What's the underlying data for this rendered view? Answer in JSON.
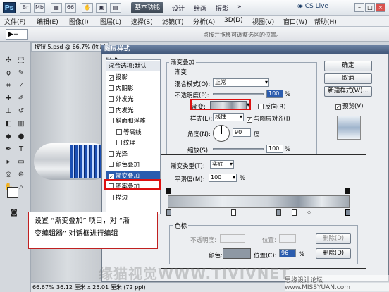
{
  "titlebar": {
    "app_logo": "Ps",
    "workspace_button": "基本功能",
    "workspace_items": [
      "设计",
      "绘画",
      "摄影"
    ],
    "cs_live": "CS Live",
    "window_controls": [
      "minimize-icon",
      "maximize-icon",
      "close-icon"
    ]
  },
  "menubar": {
    "items": [
      "文件(F)",
      "编辑(E)",
      "图像(I)",
      "图层(L)",
      "选择(S)",
      "滤镜(T)",
      "分析(A)",
      "3D(D)",
      "视图(V)",
      "窗口(W)",
      "帮助(H)"
    ]
  },
  "optionsbar": {
    "tool_preset": "▶+",
    "hint": "点按并拖移可调整选区的位置。"
  },
  "document": {
    "tab_title": "按钮 5.psd @ 66.7% (图层",
    "zoom": "66.67%",
    "doc_info": "36.12 厘米 x 25.01 厘米 (72 ppi)"
  },
  "dialog": {
    "title": "图层样式",
    "styles_header": "样式",
    "blend_options": "混合选项:默认",
    "style_items": [
      {
        "label": "投影",
        "checked": true
      },
      {
        "label": "内阴影",
        "checked": false
      },
      {
        "label": "外发光",
        "checked": false
      },
      {
        "label": "内发光",
        "checked": false
      },
      {
        "label": "斜面和浮雕",
        "checked": false
      },
      {
        "label": "等高线",
        "checked": false
      },
      {
        "label": "纹理",
        "checked": false
      },
      {
        "label": "光泽",
        "checked": false
      },
      {
        "label": "颜色叠加",
        "checked": false
      },
      {
        "label": "渐变叠加",
        "checked": true
      },
      {
        "label": "图案叠加",
        "checked": false
      },
      {
        "label": "描边",
        "checked": false
      }
    ],
    "buttons": {
      "ok": "确定",
      "cancel": "取消",
      "new_style": "新建样式(W)...",
      "preview": "预览(V)"
    },
    "gradient_overlay": {
      "group_title": "渐变叠加",
      "sub_title": "渐变",
      "blend_mode_label": "混合模式(O):",
      "blend_mode_value": "正常",
      "opacity_label": "不透明度(P):",
      "opacity_value": "100",
      "percent": "%",
      "gradient_label": "渐变:",
      "reverse_label": "反向(R)",
      "style_label": "样式(L):",
      "style_value": "线性",
      "align_label": "与图层对齐(I)",
      "angle_label": "角度(N):",
      "angle_value": "90",
      "degree": "度",
      "scale_label": "缩放(S):",
      "scale_value": "100"
    }
  },
  "gradient_editor": {
    "type_label": "渐变类型(T):",
    "type_value": "实底",
    "smoothness_label": "平滑度(M):",
    "smoothness_value": "100",
    "percent": "%",
    "stops_group": "色标",
    "opacity_label": "不透明度:",
    "position_label": "位置:",
    "delete_label": "删除(D)",
    "color_label": "颜色:",
    "color_position_label": "位置(C):",
    "color_position_value": "96",
    "color_delete_label": "删除(D)"
  },
  "callout": {
    "line1": "设置 “渐变叠加” 项目，对 “渐",
    "line2": "变编辑器” 对话框进行编辑"
  },
  "watermarks": {
    "main": "缘猫视觉WWW.TIVIVNET",
    "corner": "思缘设计论坛 www.MISSYUAN.com"
  }
}
